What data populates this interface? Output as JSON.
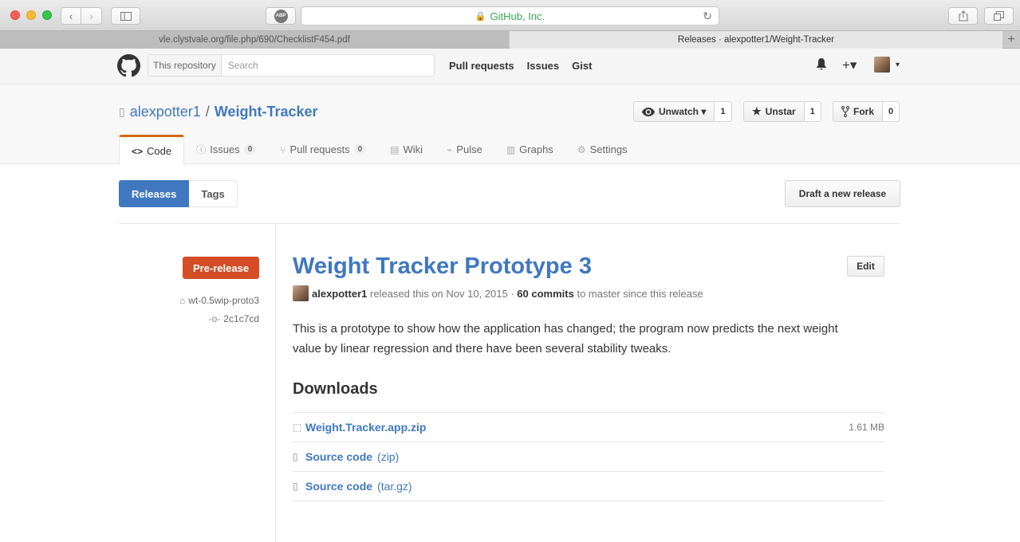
{
  "browser": {
    "url_display": "GitHub, Inc.",
    "tabs": [
      {
        "label": "vle.clystvale.org/file.php/690/ChecklistF454.pdf"
      },
      {
        "label": "Releases · alexpotter1/Weight-Tracker"
      }
    ],
    "abp_label": "ABP"
  },
  "header": {
    "search_scope": "This repository",
    "search_placeholder": "Search",
    "nav": [
      "Pull requests",
      "Issues",
      "Gist"
    ],
    "plus": "+▾"
  },
  "repo": {
    "owner": "alexpotter1",
    "separator": "/",
    "name": "Weight-Tracker",
    "actions": {
      "watch_label": "Unwatch ▾",
      "watch_count": "1",
      "star_label": "Unstar",
      "star_count": "1",
      "fork_label": "Fork",
      "fork_count": "0"
    },
    "tabs": [
      {
        "label": "Code",
        "icon": "code-icon"
      },
      {
        "label": "Issues",
        "count": "0",
        "icon": "issue-icon"
      },
      {
        "label": "Pull requests",
        "count": "0",
        "icon": "pr-icon"
      },
      {
        "label": "Wiki",
        "icon": "book-icon"
      },
      {
        "label": "Pulse",
        "icon": "pulse-icon"
      },
      {
        "label": "Graphs",
        "icon": "graph-icon"
      },
      {
        "label": "Settings",
        "icon": "gear-icon"
      }
    ]
  },
  "subnav": {
    "releases": "Releases",
    "tags": "Tags",
    "draft": "Draft a new release"
  },
  "release": {
    "badge": "Pre-release",
    "tag": "wt-0.5wip-proto3",
    "commit": "2c1c7cd",
    "title": "Weight Tracker Prototype 3",
    "edit": "Edit",
    "author": "alexpotter1",
    "released_text": "released this on Nov 10, 2015 ·",
    "commits": "60 commits",
    "since_text": "to master since this release",
    "description": "This is a prototype to show how the application has changed; the program now predicts the next weight value by linear regression and there have been several stability tweaks.",
    "downloads_heading": "Downloads",
    "downloads": [
      {
        "name": "Weight.Tracker.app.zip",
        "suffix": "",
        "size": "1.61 MB"
      },
      {
        "name": "Source code",
        "suffix": "(zip)",
        "size": ""
      },
      {
        "name": "Source code",
        "suffix": "(tar.gz)",
        "size": ""
      }
    ]
  }
}
